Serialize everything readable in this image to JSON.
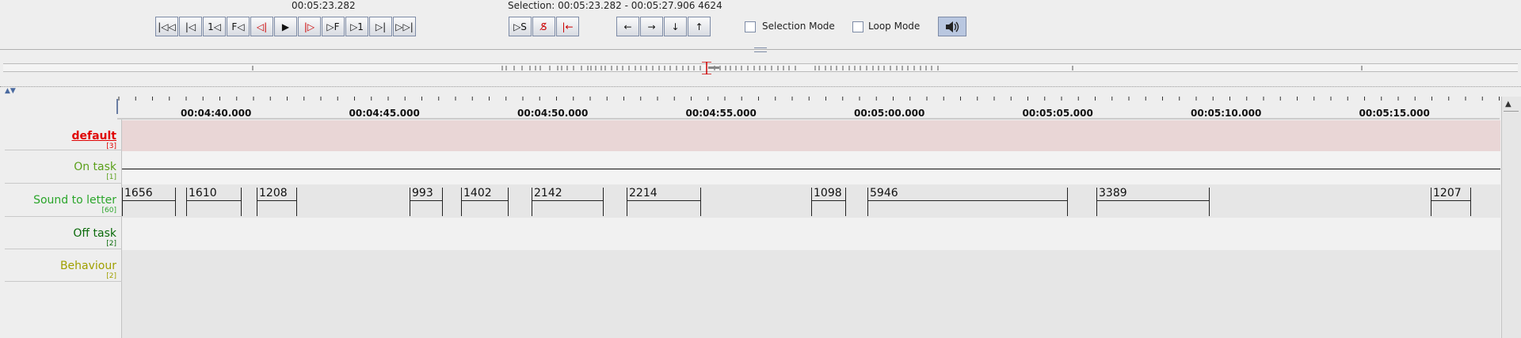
{
  "toolbar": {
    "current_time": "00:05:23.282",
    "selection": "Selection: 00:05:23.282 - 00:05:27.906  4624",
    "nav_buttons": [
      {
        "name": "go-to-begin",
        "glyph": "|◁◁"
      },
      {
        "name": "previous-scrollview",
        "glyph": "|◁"
      },
      {
        "name": "previous-second",
        "glyph": "1◁"
      },
      {
        "name": "previous-frame",
        "glyph": "F◁"
      },
      {
        "name": "previous-pixel",
        "glyph": "◁|"
      },
      {
        "name": "play",
        "glyph": "▶"
      },
      {
        "name": "next-pixel",
        "glyph": "|▷"
      },
      {
        "name": "next-frame",
        "glyph": "▷F"
      },
      {
        "name": "next-second",
        "glyph": "▷1"
      },
      {
        "name": "next-scrollview",
        "glyph": "▷|"
      },
      {
        "name": "go-to-end",
        "glyph": "▷▷|"
      }
    ],
    "selection_buttons": [
      {
        "name": "play-selection",
        "glyph": "▷S"
      },
      {
        "name": "clear-selection",
        "glyph": "S̸"
      },
      {
        "name": "selection-to-begin",
        "glyph": "|←"
      }
    ],
    "arrow_buttons": [
      {
        "name": "left",
        "glyph": "←"
      },
      {
        "name": "right",
        "glyph": "→"
      },
      {
        "name": "down",
        "glyph": "↓"
      },
      {
        "name": "up",
        "glyph": "↑"
      }
    ],
    "selection_mode_label": "Selection Mode",
    "loop_mode_label": "Loop Mode"
  },
  "ruler": {
    "labels": [
      "00:04:40.000",
      "00:04:45.000",
      "00:04:50.000",
      "00:04:55.000",
      "00:05:00.000",
      "00:05:05.000",
      "00:05:10.000",
      "00:05:15.000"
    ]
  },
  "tiers": [
    {
      "name": "default",
      "count": "[3]",
      "color": "#e00000",
      "underline": true
    },
    {
      "name": "On task",
      "count": "[1]",
      "color": "#5aa01a",
      "underline": false
    },
    {
      "name": "Sound to letter",
      "count": "[60]",
      "color": "#2aa52a",
      "underline": false
    },
    {
      "name": "Off task",
      "count": "[2]",
      "color": "#0a6a0a",
      "underline": false
    },
    {
      "name": "Behaviour",
      "count": "[2]",
      "color": "#a0a000",
      "underline": false
    }
  ],
  "sound_to_letter_annotations": [
    "1656",
    "1610",
    "1208",
    "993",
    "1402",
    "2142",
    "2214",
    "1098",
    "5946",
    "3389",
    "1207"
  ],
  "colors": {
    "accent_red": "#cc0000",
    "default_row": "#e9d6d6",
    "row_bg": "#e6e6e6"
  }
}
